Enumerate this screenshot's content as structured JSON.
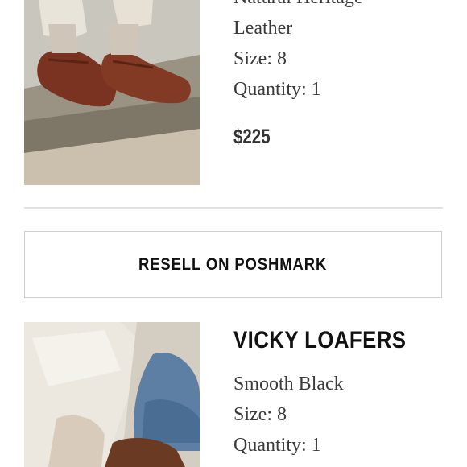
{
  "item1": {
    "name_line1": "Natural Heritage",
    "name_line2": "Leather",
    "size": "Size: 8",
    "quantity": "Quantity: 1",
    "price": "$225",
    "image_icon": "loafers-photo"
  },
  "resell": {
    "label": "RESELL ON POSHMARK"
  },
  "item2": {
    "title": "VICKY LOAFERS",
    "color": "Smooth Black",
    "size": "Size: 8",
    "quantity": "Quantity: 1",
    "image_icon": "loafers-photo"
  },
  "colors": {
    "divider": "#e2e2e2",
    "button_border": "#cfcfcf",
    "text": "#3a3a3a",
    "title": "#111111"
  }
}
